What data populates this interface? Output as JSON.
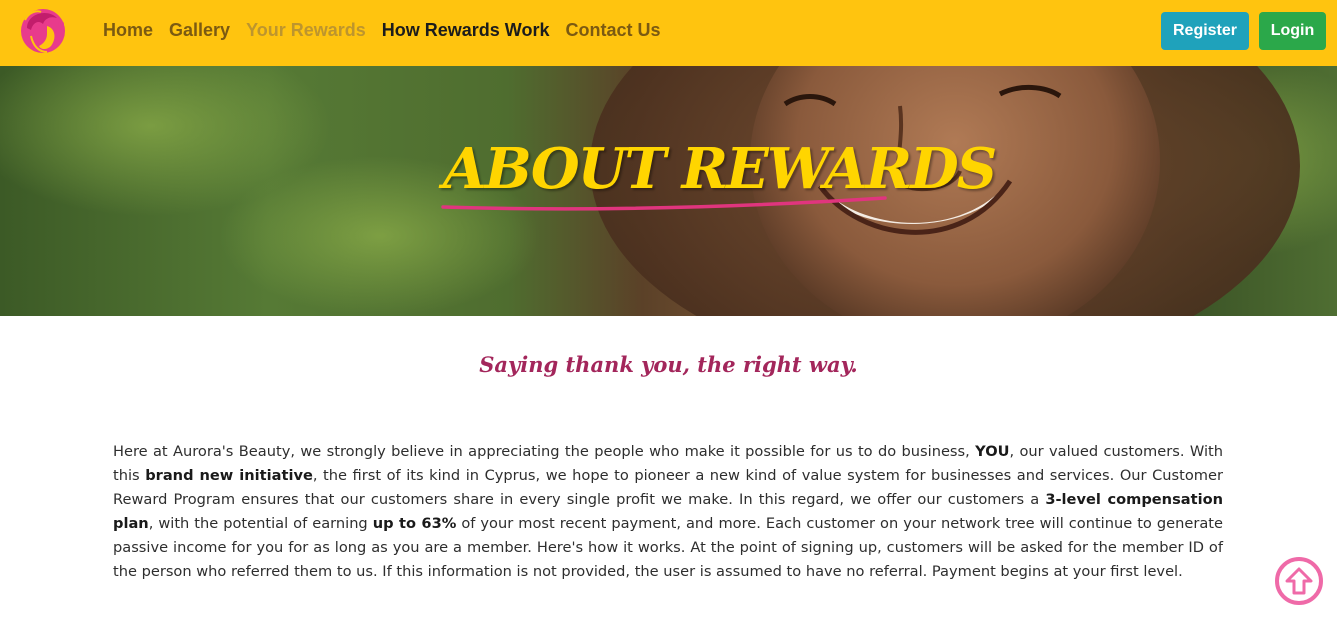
{
  "nav": {
    "links": [
      "Home",
      "Gallery",
      "Your Rewards",
      "How Rewards Work",
      "Contact Us"
    ],
    "register_label": "Register",
    "login_label": "Login"
  },
  "hero": {
    "title": "ABOUT REWARDS"
  },
  "content": {
    "tagline": "Saying thank you, the right way.",
    "p1": "Here at Aurora's Beauty, we strongly believe in appreciating the people who make it possible for us to do business, ",
    "b1": "YOU",
    "p2": ", our valued customers. With this ",
    "b2": "brand new initiative",
    "p3": ", the first of its kind in Cyprus, we hope to pioneer a new kind of value system for businesses and services. Our Customer Reward Program ensures that our customers share in every single profit we make. In this regard, we offer our customers a ",
    "b3": "3-level compensation plan",
    "p4": ", with the potential of earning ",
    "b4": "up to 63%",
    "p5": " of your most recent payment, and more. Each customer on your network tree will continue to generate passive income for you for as long as you are a member. Here's how it works. At the point of signing up, customers will be asked for the member ID of the person who referred them to us. If this information is not provided, the user is assumed to have no referral. Payment begins at your first level."
  },
  "colors": {
    "navbar": "#ffc40f",
    "title": "#ffd500",
    "underline": "#e0357e",
    "tagline": "#a3265b",
    "register": "#1fa2bb",
    "login": "#2ba84a",
    "scroll_ring": "#ef6aa8"
  },
  "icons": {
    "logo": "woman-hair-logo-icon",
    "scroll": "arrow-up-icon"
  }
}
